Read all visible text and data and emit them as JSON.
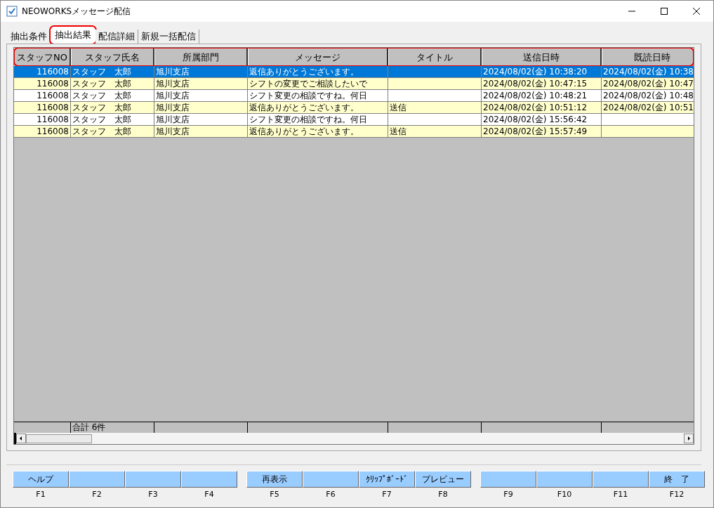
{
  "window": {
    "title": "NEOWORKSメッセージ配信"
  },
  "tabs": [
    {
      "label": "抽出条件",
      "selected": false,
      "highlighted": false
    },
    {
      "label": "抽出結果",
      "selected": true,
      "highlighted": true
    },
    {
      "label": "配信詳細",
      "selected": false,
      "highlighted": false
    },
    {
      "label": "新規一括配信",
      "selected": false,
      "highlighted": false
    }
  ],
  "table": {
    "header_highlighted": true,
    "columns": [
      "スタッフNO",
      "スタッフ氏名",
      "所属部門",
      "メッセージ",
      "タイトル",
      "送信日時",
      "既読日時"
    ],
    "rows": [
      {
        "selected": true,
        "staff_no": "116008",
        "staff_name": "スタッフ　太郎",
        "department": "旭川支店",
        "message": "返信ありがとうございます。",
        "sent_at": "2024/08/02(金) 10:38:20",
        "read_at": "2024/08/02(金) 10:38"
      },
      {
        "selected": false,
        "staff_no": "116008",
        "staff_name": "スタッフ　太郎",
        "department": "旭川支店",
        "message": "シフトの変更でご相談したいで",
        "sent_at": "2024/08/02(金) 10:47:15",
        "read_at": "2024/08/02(金) 10:47"
      },
      {
        "selected": false,
        "staff_no": "116008",
        "staff_name": "スタッフ　太郎",
        "department": "旭川支店",
        "message": "シフト変更の相談ですね。何日",
        "sent_at": "2024/08/02(金) 10:48:21",
        "read_at": "2024/08/02(金) 10:48"
      },
      {
        "selected": false,
        "staff_no": "116008",
        "staff_name": "スタッフ　太郎",
        "department": "旭川支店",
        "message": "返信ありがとうございます。",
        "title": "送信",
        "sent_at": "2024/08/02(金) 10:51:12",
        "read_at": "2024/08/02(金) 10:51"
      },
      {
        "selected": false,
        "staff_no": "116008",
        "staff_name": "スタッフ　太郎",
        "department": "旭川支店",
        "message": "シフト変更の相談ですね。何日",
        "sent_at": "2024/08/02(金) 15:56:42"
      },
      {
        "selected": false,
        "staff_no": "116008",
        "staff_name": "スタッフ　太郎",
        "department": "旭川支店",
        "message": "返信ありがとうございます。",
        "title": "送信",
        "sent_at": "2024/08/02(金) 15:57:49"
      }
    ],
    "footer": {
      "staff_name": "合計 6件"
    }
  },
  "function_keys": [
    {
      "label": "ヘルプ",
      "key": "F1"
    },
    {
      "key": "F2"
    },
    {
      "key": "F3"
    },
    {
      "key": "F4"
    },
    {
      "label": "再表示",
      "key": "F5"
    },
    {
      "key": "F6"
    },
    {
      "label": "ｸﾘｯﾌﾟﾎﾞｰﾄﾞ",
      "key": "F7"
    },
    {
      "label": "プレビュー",
      "key": "F8"
    },
    {
      "key": "F9"
    },
    {
      "key": "F10"
    },
    {
      "key": "F11"
    },
    {
      "label": "終　了",
      "key": "F12"
    }
  ]
}
